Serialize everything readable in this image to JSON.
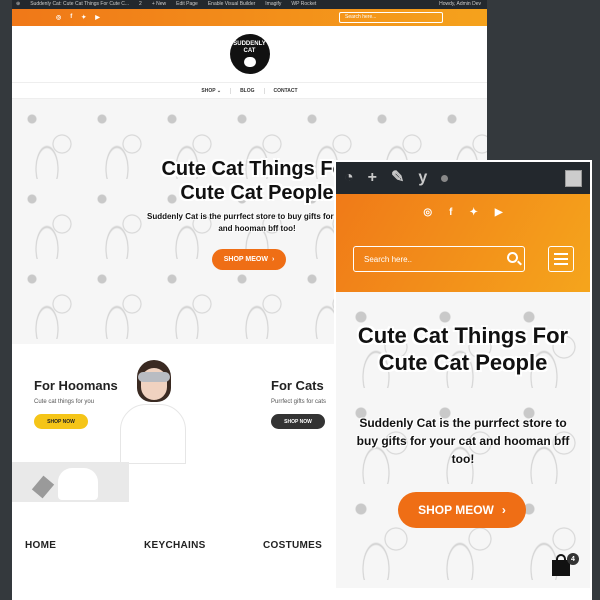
{
  "desktop": {
    "wp_bar": {
      "site": "Suddenly Cat: Cute Cat Things For Cute C...",
      "comments": "2",
      "new": "+ New",
      "edit": "Edit Page",
      "builder": "Enable Visual Builder",
      "imagify": "Imagify",
      "rocket": "WP Rocket",
      "howdy": "Howdy, Admin Dev"
    },
    "search_placeholder": "Search here...",
    "logo_text": "SUDDENLY CAT",
    "nav": [
      "SHOP ⌄",
      "BLOG",
      "CONTACT"
    ],
    "hero": {
      "title": "Cute Cat Things For Cute Cat People",
      "subtitle": "Suddenly Cat is the purrfect store to buy gifts for your cat and hooman bff too!",
      "button": "SHOP MEOW"
    },
    "categories": [
      {
        "title": "For Hoomans",
        "sub": "Cute cat things for you",
        "button": "SHOP NOW",
        "color": "#f5c518"
      },
      {
        "title": "For Cats",
        "sub": "Purrfect gifts for cats",
        "button": "SHOP NOW",
        "color": "#333333"
      }
    ],
    "footer_links": [
      "HOME",
      "KEYCHAINS",
      "COSTUMES"
    ]
  },
  "mobile": {
    "search_placeholder": "Search here..",
    "hero": {
      "title": "Cute Cat Things For Cute Cat People",
      "subtitle": "Suddenly Cat is the purrfect store to buy gifts for your cat and hooman bff too!",
      "button": "SHOP MEOW"
    },
    "cart_count": "4"
  },
  "social_icons": [
    "instagram-icon",
    "facebook-icon",
    "twitter-icon",
    "youtube-icon"
  ],
  "colors": {
    "accent": "#ef6e15",
    "bar": "#23282d",
    "gradient_start": "#f07818",
    "gradient_end": "#f5a21c"
  }
}
